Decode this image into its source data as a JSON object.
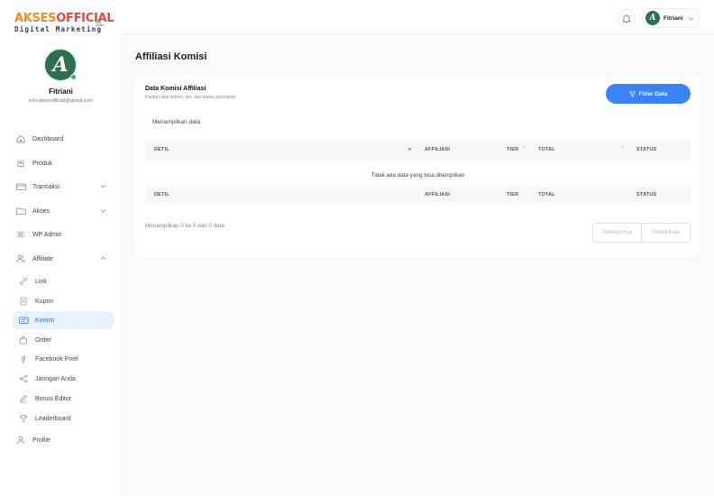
{
  "brand": {
    "logo_left": "AKSES",
    "logo_right": "OFFICIAL",
    "logo_sub": "Digital Marketing"
  },
  "profile": {
    "initial": "A",
    "name": "Fitriani",
    "email": "info.aksesofficial@gmail.com"
  },
  "sidebar": {
    "items": [
      {
        "label": "Dashboard",
        "icon": "home-icon"
      },
      {
        "label": "Produk",
        "icon": "box-icon"
      },
      {
        "label": "Transaksi",
        "icon": "credit-card-icon"
      },
      {
        "label": "Akses",
        "icon": "folder-icon"
      },
      {
        "label": "WP Admin",
        "icon": "settings-icon"
      },
      {
        "label": "Affiliate",
        "icon": "users-icon"
      },
      {
        "label": "Link",
        "icon": "link-icon"
      },
      {
        "label": "Kupon",
        "icon": "ticket-icon"
      },
      {
        "label": "Komisi",
        "icon": "wallet-icon",
        "active": true
      },
      {
        "label": "Order",
        "icon": "shopping-bag-icon"
      },
      {
        "label": "Facebook Pixel",
        "icon": "facebook-icon"
      },
      {
        "label": "Jaringan Anda",
        "icon": "share-icon"
      },
      {
        "label": "Bonus Editor",
        "icon": "edit-icon"
      },
      {
        "label": "Leaderboard",
        "icon": "trophy-icon"
      },
      {
        "label": "Profile",
        "icon": "user-icon"
      }
    ]
  },
  "header": {
    "user_initial": "A",
    "user_name": "Fitriani"
  },
  "main": {
    "title": "Affiliasi Komisi",
    "card": {
      "title": "Data Komisi Affiliasi",
      "subtitle": "Pantau nilai komisi, tier, dan status pencairan",
      "filter_label": "Filter Data",
      "showing_label": "Menampilkan data",
      "columns": [
        "DETIL",
        "AFFILIASI",
        "TIER",
        "TOTAL",
        "STATUS"
      ],
      "empty_message": "Tidak ada data yang bisa ditampilkan",
      "info": "Menampilkan 0 ke 0 dari 0 data",
      "prev_label": "Sebelumnya",
      "next_label": "Selanjutnya"
    }
  },
  "colors": {
    "primary": "#3b82f6",
    "active_bg": "#e8f1fc",
    "avatar": "#2e6f4e",
    "logo_orange": "#f28c28",
    "logo_red": "#e8453c"
  }
}
